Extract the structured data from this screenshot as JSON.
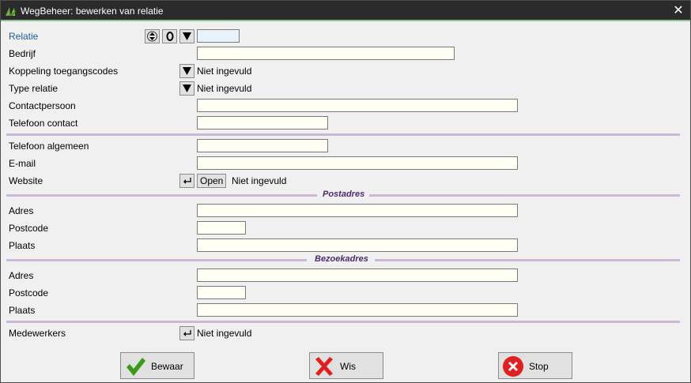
{
  "window": {
    "title": "WegBeheer: bewerken van relatie",
    "close_label": "✕"
  },
  "fields": {
    "relatie": {
      "label": "Relatie",
      "value": ""
    },
    "bedrijf": {
      "label": "Bedrijf",
      "value": ""
    },
    "koppeling": {
      "label": "Koppeling toegangscodes",
      "value": "Niet ingevuld"
    },
    "type_relatie": {
      "label": "Type relatie",
      "value": "Niet ingevuld"
    },
    "contactpersoon": {
      "label": "Contactpersoon",
      "value": ""
    },
    "telefoon_contact": {
      "label": "Telefoon contact",
      "value": ""
    },
    "telefoon_algemeen": {
      "label": "Telefoon algemeen",
      "value": ""
    },
    "email": {
      "label": "E-mail",
      "value": ""
    },
    "website": {
      "label": "Website",
      "open_label": "Open",
      "value": "Niet ingevuld"
    },
    "medewerkers": {
      "label": "Medewerkers",
      "value": "Niet ingevuld"
    }
  },
  "postadres": {
    "section_title": "Postadres",
    "adres_label": "Adres",
    "adres_value": "",
    "postcode_label": "Postcode",
    "postcode_value": "",
    "plaats_label": "Plaats",
    "plaats_value": ""
  },
  "bezoekadres": {
    "section_title": "Bezoekadres",
    "adres_label": "Adres",
    "adres_value": "",
    "postcode_label": "Postcode",
    "postcode_value": "",
    "plaats_label": "Plaats",
    "plaats_value": ""
  },
  "buttons": {
    "bewaar": {
      "label": "Bewaar",
      "icon": "checkmark-icon",
      "color": "#3a9a1a"
    },
    "wis": {
      "label": "Wis",
      "icon": "x-icon",
      "color": "#e02020"
    },
    "stop": {
      "label": "Stop",
      "icon": "stop-icon",
      "color": "#e02020"
    }
  },
  "colors": {
    "titlebar": "#2b2b2b",
    "link_label": "#1f5e9e",
    "separator": "#c9b8d6",
    "section_title": "#4d2b6e",
    "field_bg": "#fffff4"
  }
}
